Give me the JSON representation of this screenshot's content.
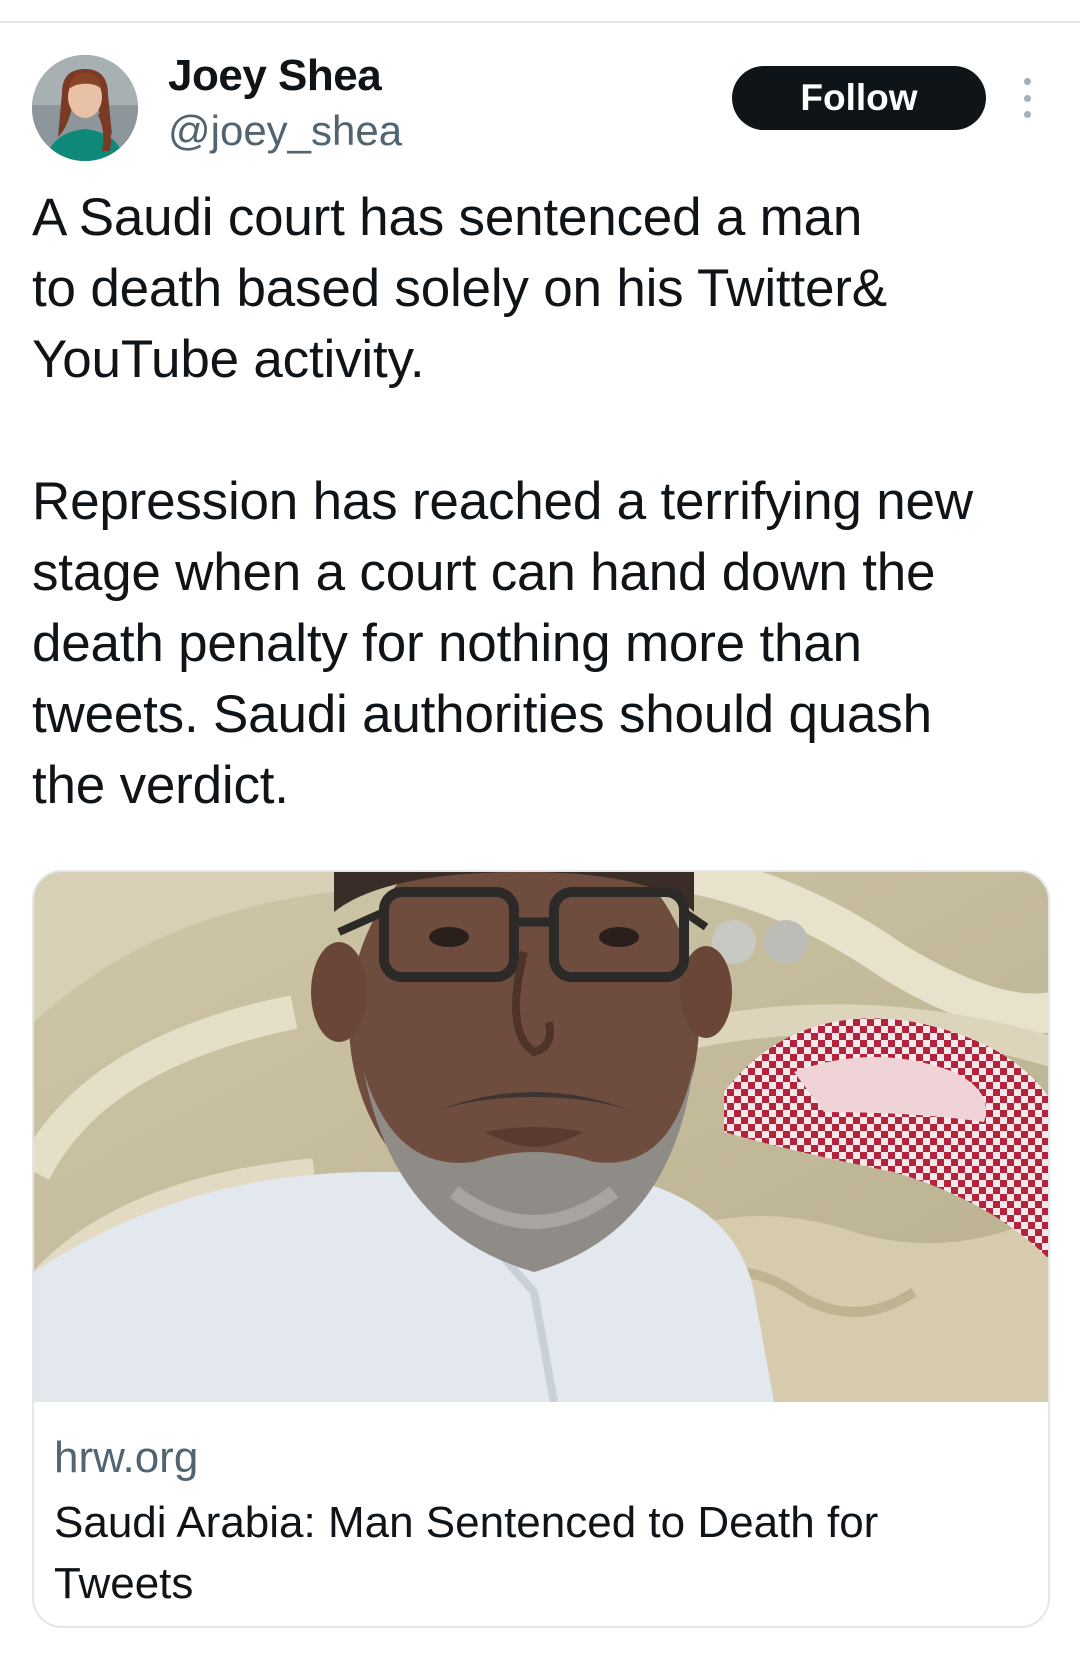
{
  "tweet": {
    "author": {
      "name": "Joey Shea",
      "handle": "@joey_shea"
    },
    "follow_label": "Follow",
    "text_lines_p1": [
      "A Saudi court has sentenced a man",
      "to death based solely on his Twitter&",
      "YouTube activity."
    ],
    "text_lines_p2": [
      "Repression has reached a terrifying new",
      "stage when a court can hand down the",
      "death penalty for nothing more than",
      "tweets. Saudi authorities should quash",
      "the verdict."
    ]
  },
  "link_card": {
    "domain": "hrw.org",
    "title_lines": [
      "Saudi Arabia: Man Sentenced to Death for",
      "Tweets"
    ]
  },
  "colors": {
    "text": "#0f1419",
    "secondary_text": "#536471",
    "follow_button_bg": "#0f1419",
    "follow_button_text": "#ffffff",
    "card_border": "#e3e6e8"
  },
  "icons": {
    "more": "more-vertical-icon"
  }
}
